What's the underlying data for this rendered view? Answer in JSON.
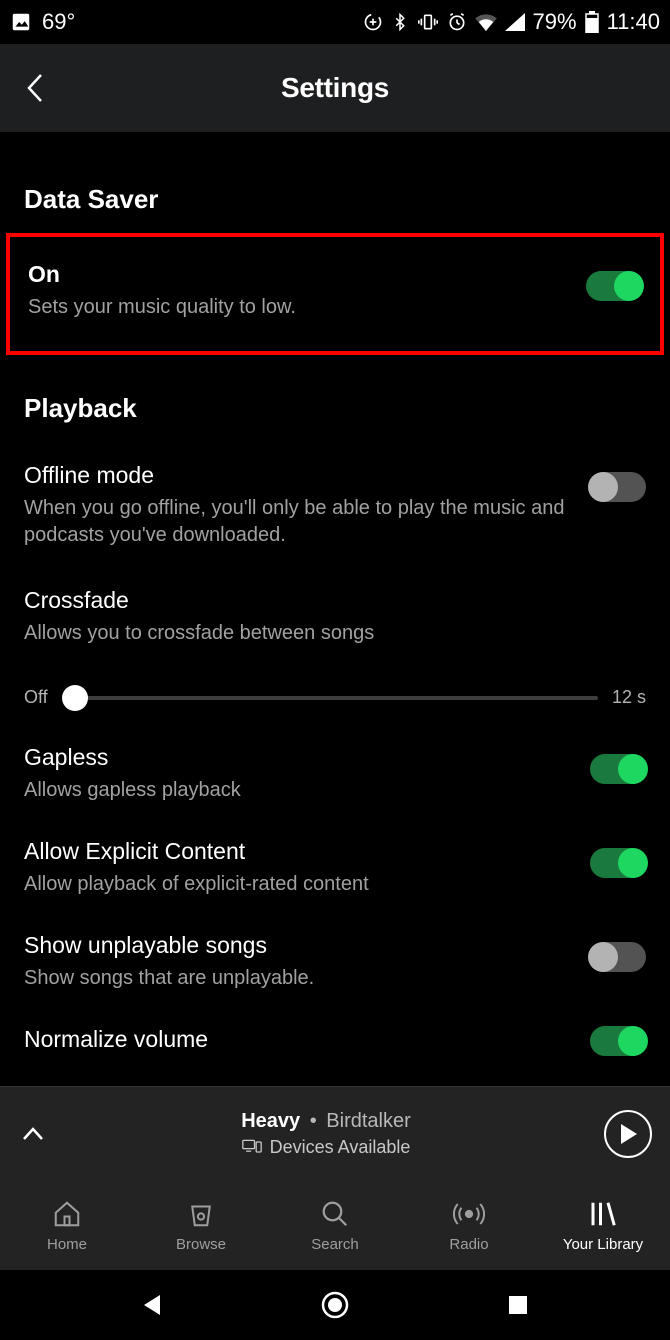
{
  "status": {
    "temp": "69°",
    "battery_pct": "79%",
    "time": "11:40"
  },
  "navbar": {
    "title": "Settings"
  },
  "sections": {
    "data_saver_header": "Data Saver",
    "playback_header": "Playback"
  },
  "settings": {
    "data_saver": {
      "title": "On",
      "desc": "Sets your music quality to low.",
      "enabled": true
    },
    "offline": {
      "title": "Offline mode",
      "desc": "When you go offline, you'll only be able to play the music and podcasts you've downloaded.",
      "enabled": false
    },
    "crossfade": {
      "title": "Crossfade",
      "desc": "Allows you to crossfade between songs",
      "slider_min_label": "Off",
      "slider_max_label": "12 s",
      "value": 0,
      "max": 12
    },
    "gapless": {
      "title": "Gapless",
      "desc": "Allows gapless playback",
      "enabled": true
    },
    "explicit": {
      "title": "Allow Explicit Content",
      "desc": "Allow playback of explicit-rated content",
      "enabled": true
    },
    "unplayable": {
      "title": "Show unplayable songs",
      "desc": "Show songs that are unplayable.",
      "enabled": false
    },
    "normalize": {
      "title": "Normalize volume",
      "enabled": true
    }
  },
  "now_playing": {
    "track": "Heavy",
    "separator": "•",
    "artist": "Birdtalker",
    "devices_label": "Devices Available"
  },
  "tabs": {
    "home": "Home",
    "browse": "Browse",
    "search": "Search",
    "radio": "Radio",
    "library": "Your Library"
  }
}
